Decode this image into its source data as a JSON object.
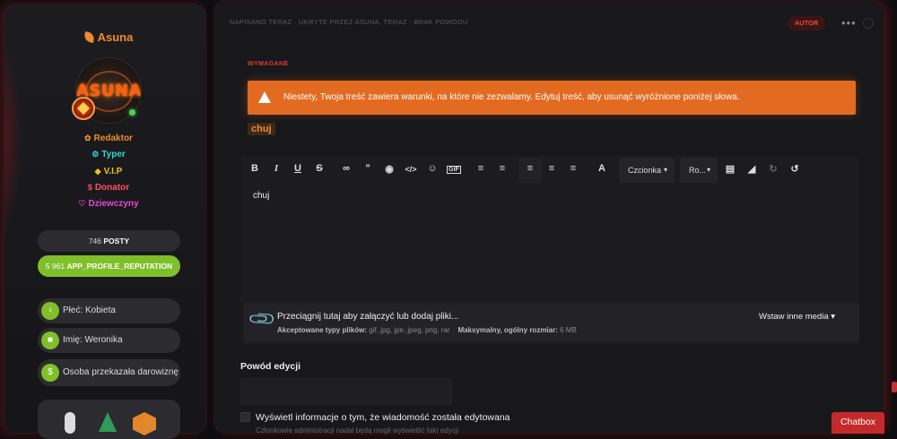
{
  "profile": {
    "username": "Asuna",
    "avatar_text": "ASUNA",
    "roles": [
      {
        "label": "Redaktor",
        "color": "#f08a2a",
        "icon": "leaf-icon"
      },
      {
        "label": "Typer",
        "color": "#2fd6d6",
        "icon": "gear-icon"
      },
      {
        "label": "V.I.P",
        "color": "#f2c21b",
        "icon": "diamond-icon"
      },
      {
        "label": "Donator",
        "color": "#ff4f6a",
        "icon": "dollar-icon"
      },
      {
        "label": "Dziewczyny",
        "color": "#e24ad6",
        "icon": "heart-icon"
      }
    ],
    "posts_count": "746",
    "posts_label": "POSTY",
    "reputation_count": "5 961",
    "reputation_label": "APP_PROFILE_REPUTATION",
    "fields": [
      {
        "icon": "gender-icon",
        "text": "Płeć: Kobieta"
      },
      {
        "icon": "id-icon",
        "text": "Imię: Weronika"
      },
      {
        "icon": "dollar-icon",
        "text": "Osoba przekazała darowiznę"
      }
    ]
  },
  "post": {
    "meta": "NAPISANO TERAZ · UKRYTE PRZEZ ASUNA, TERAZ - BRAK POWODU",
    "author_badge": "AUTOR",
    "more": "•••"
  },
  "form": {
    "required_label": "WYMAGANE",
    "warning": "Niestety, Twoja treść zawiera warunki, na które nie zezwalamy. Edytuj treść, aby usunąć wyróżnione poniżej słowa.",
    "highlighted_word": "chuj",
    "editor_content": "chuj",
    "font_dropdown": "Czcionka",
    "size_dropdown": "Ro...",
    "attach_title": "Przeciągnij tutaj aby załączyć lub dodaj pliki...",
    "accepted_label": "Akceptowane typy plików:",
    "accepted_types": "gif, jpg, jpe, jpeg, png, rar",
    "max_label": "Maksymalny, ogólny rozmiar:",
    "max_size": "6 MB",
    "insert_media": "Wstaw inne media",
    "reason_label": "Powód edycji",
    "show_edit_label": "Wyświetl informacje o tym, że wiadomość została edytowana",
    "show_edit_sub": "Członkowie administracji nadal będą mogli wyświetlić fakt edycji"
  },
  "chatbox": "Chatbox",
  "colors": {
    "accent": "#e36b21",
    "danger": "#d93b3b",
    "green": "#7fbf2a"
  }
}
